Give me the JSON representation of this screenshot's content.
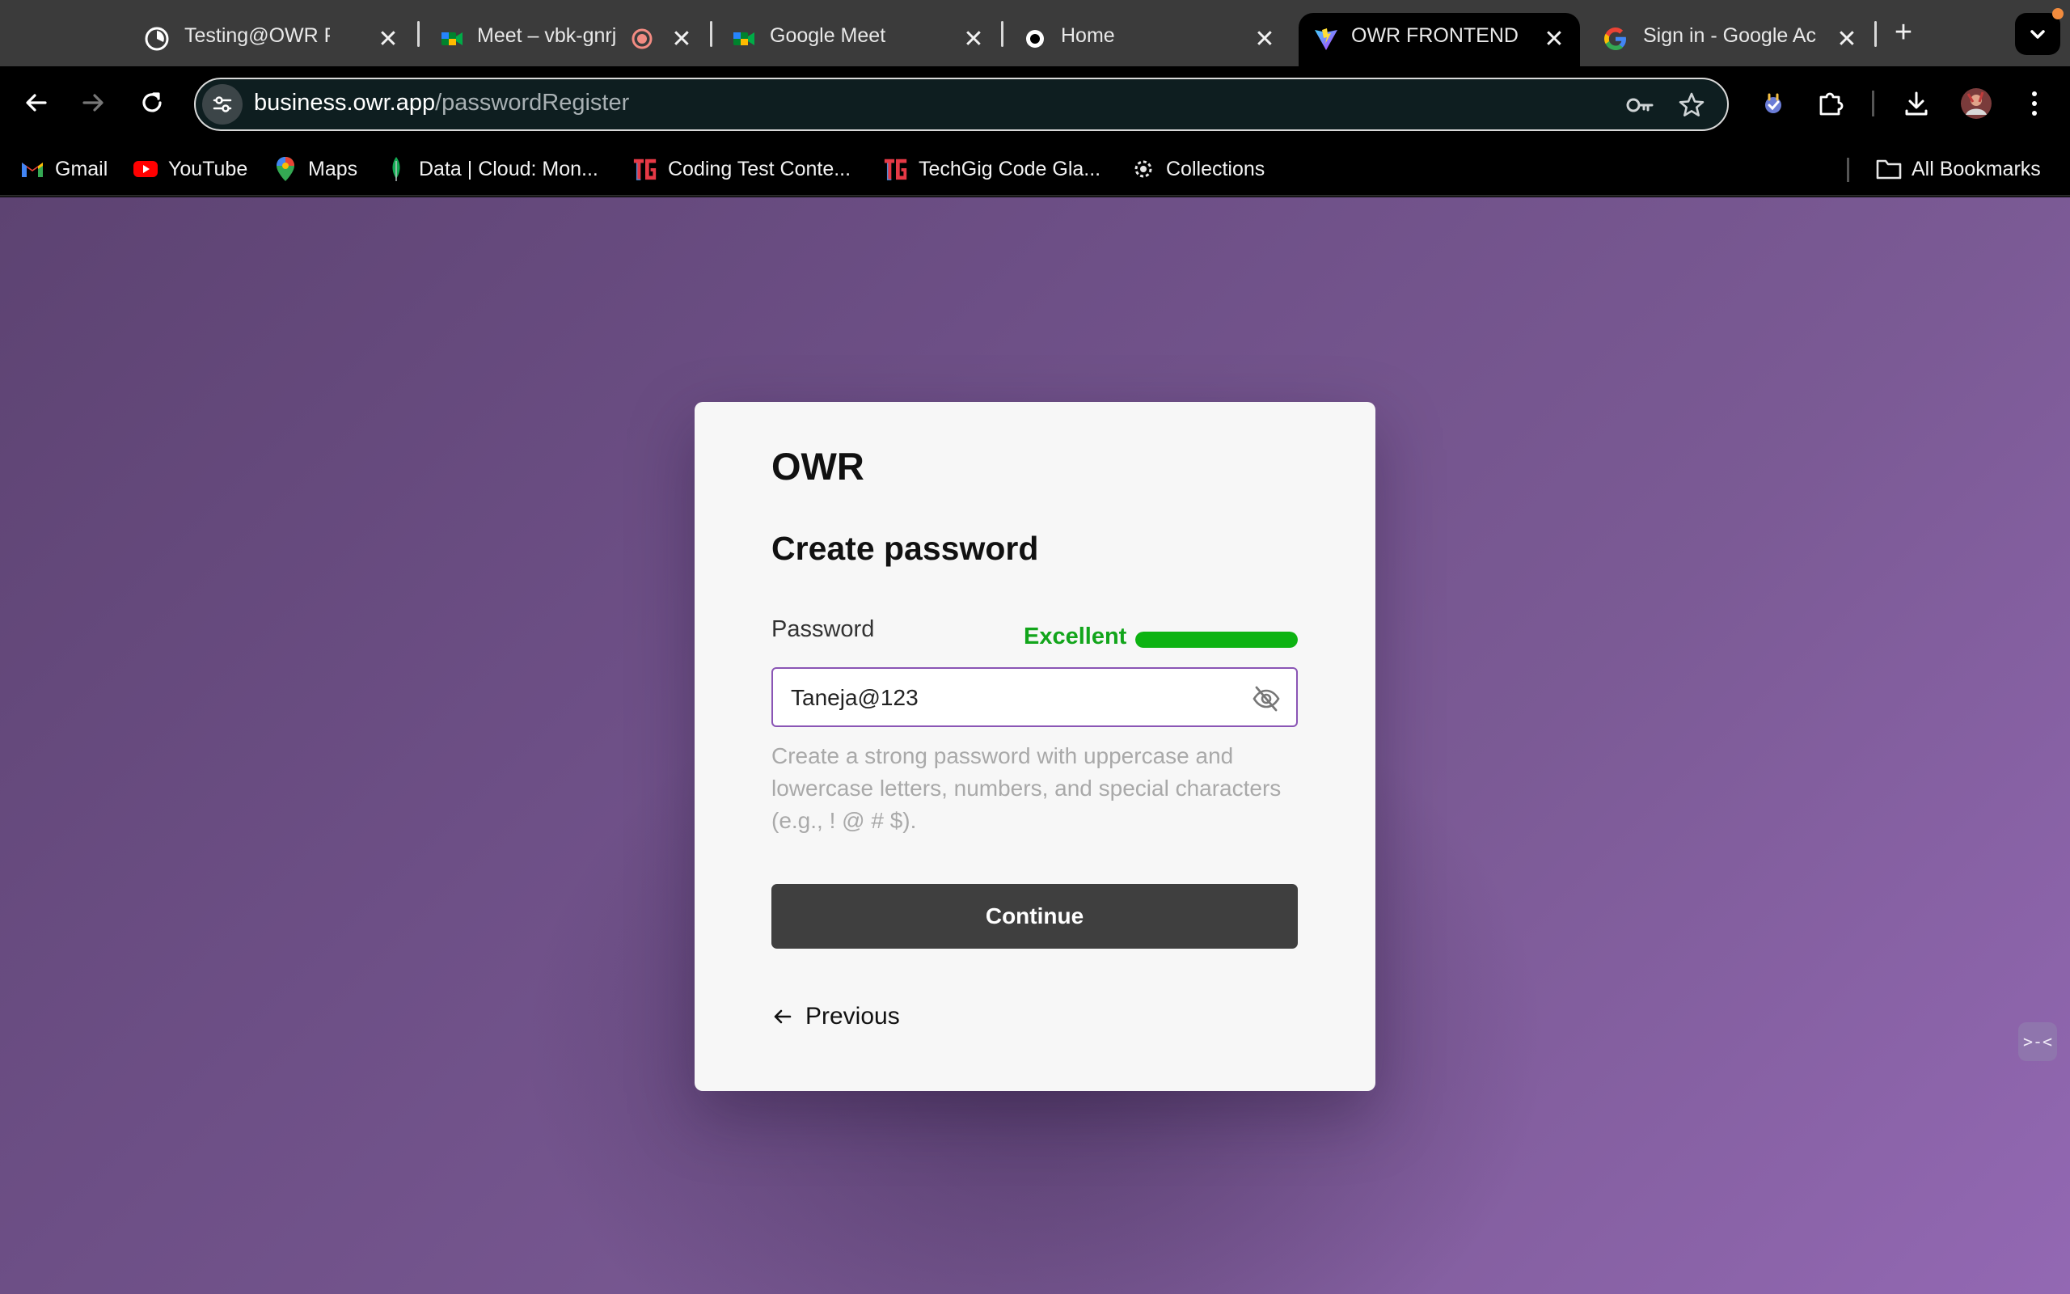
{
  "tabs": [
    {
      "title": "Testing@OWR Proje",
      "favicon": "clock-favicon",
      "active": false
    },
    {
      "title": "Meet – vbk-gnrj",
      "favicon": "google-meet-favicon",
      "active": false,
      "recording": true
    },
    {
      "title": "Google Meet",
      "favicon": "google-meet-favicon",
      "active": false
    },
    {
      "title": "Home",
      "favicon": "circle-favicon",
      "active": false
    },
    {
      "title": "OWR FRONTEND",
      "favicon": "vite-favicon",
      "active": true
    },
    {
      "title": "Sign in - Google Ac",
      "favicon": "google-favicon",
      "active": false
    }
  ],
  "address_bar": {
    "domain": "business.owr.app",
    "path": "/passwordRegister"
  },
  "bookmarks": [
    {
      "label": "Gmail",
      "icon": "gmail-icon"
    },
    {
      "label": "YouTube",
      "icon": "youtube-icon"
    },
    {
      "label": "Maps",
      "icon": "maps-icon"
    },
    {
      "label": "Data | Cloud: Mon...",
      "icon": "mongodb-leaf-icon"
    },
    {
      "label": "Coding Test Conte...",
      "icon": "techgig-icon"
    },
    {
      "label": "TechGig Code Gla...",
      "icon": "techgig-icon"
    },
    {
      "label": "Collections",
      "icon": "collections-icon"
    }
  ],
  "all_bookmarks_label": "All Bookmarks",
  "card": {
    "brand": "OWR",
    "heading": "Create password",
    "password_label": "Password",
    "strength_label": "Excellent",
    "strength_level": 1.0,
    "password_value": "Taneja@123",
    "hint": "Create a strong password with uppercase and lowercase letters, numbers, and special characters (e.g., ! @ # $).",
    "continue_label": "Continue",
    "previous_label": "Previous"
  },
  "colors": {
    "strength": "#0db312",
    "input_border": "#8a55b5",
    "button_bg": "#3f3f3f"
  }
}
